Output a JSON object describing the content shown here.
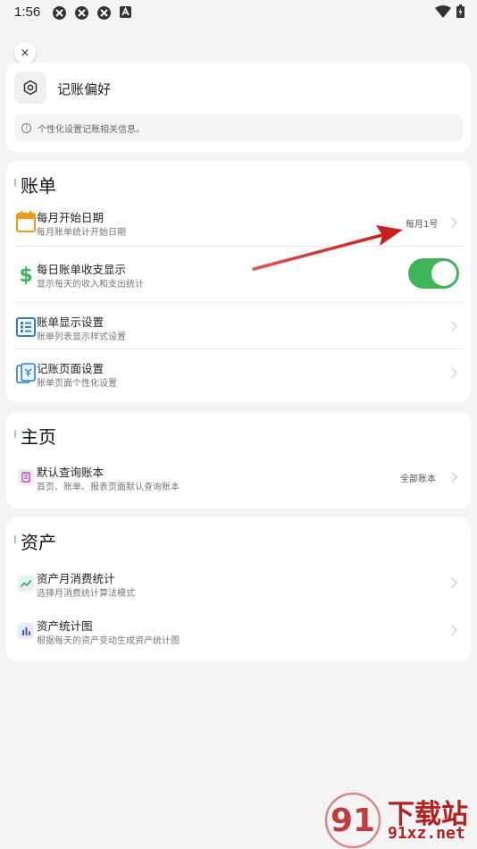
{
  "status": {
    "time": "1:56"
  },
  "preferences": {
    "close_label": "×",
    "title": "记账偏好",
    "info": "个性化设置记账相关信息。"
  },
  "bill_section": {
    "title": "账单",
    "rows": [
      {
        "title": "每月开始日期",
        "subtitle": "每月账单统计开始日期",
        "value": "每月1号",
        "icon": "calendar-icon"
      },
      {
        "title": "每日账单收支显示",
        "subtitle": "显示每天的收入和支出统计",
        "toggle": true,
        "icon": "dollar-icon"
      },
      {
        "title": "账单显示设置",
        "subtitle": "账单列表显示样式设置",
        "icon": "list-icon"
      },
      {
        "title": "记账页面设置",
        "subtitle": "账单页面个性化设置",
        "icon": "receipt-icon"
      }
    ]
  },
  "home_section": {
    "title": "主页",
    "rows": [
      {
        "title": "默认查询账本",
        "subtitle": "首页、账单、报表页面默认查询账本",
        "value": "全部账本",
        "icon": "ledger-icon"
      }
    ]
  },
  "asset_section": {
    "title": "资产",
    "rows": [
      {
        "title": "资产月消费统计",
        "subtitle": "选择月消费统计算法模式",
        "icon": "trend-icon"
      },
      {
        "title": "资产统计图",
        "subtitle": "根据每天的资产变动生成资产统计图",
        "icon": "bar-chart-icon"
      }
    ]
  },
  "watermark": {
    "main": "下载站",
    "sub": "91xz.net"
  },
  "colors": {
    "toggle_on": "#3fb55a",
    "arrow": "#d42a2a",
    "watermark": "#b51f1f"
  }
}
